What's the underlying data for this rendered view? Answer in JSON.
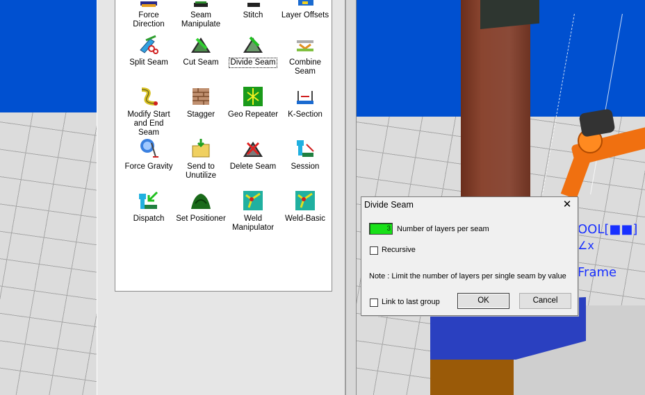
{
  "viewport": {
    "tool_label": "OOL[■■]",
    "axis_label": "∠x",
    "frame_label": "Frame"
  },
  "tools": [
    {
      "name": "force-direction",
      "label1": "Force",
      "label2": "Direction",
      "icon": "force-direction-icon"
    },
    {
      "name": "seam-manipulate",
      "label1": "Seam",
      "label2": "Manipulate",
      "icon": "seam-manipulate-icon"
    },
    {
      "name": "stitch",
      "label1": "Stitch",
      "label2": "",
      "icon": "stitch-icon"
    },
    {
      "name": "layer-offsets",
      "label1": "Layer Offsets",
      "label2": "",
      "icon": "layer-offsets-icon"
    },
    {
      "name": "split-seam",
      "label1": "Split Seam",
      "label2": "",
      "icon": "split-seam-icon"
    },
    {
      "name": "cut-seam",
      "label1": "Cut Seam",
      "label2": "",
      "icon": "cut-seam-icon"
    },
    {
      "name": "divide-seam",
      "label1": "Divide Seam",
      "label2": "",
      "icon": "divide-seam-icon"
    },
    {
      "name": "combine-seam",
      "label1": "Combine Seam",
      "label2": "",
      "icon": "combine-seam-icon"
    },
    {
      "name": "modify-start-end",
      "label1": "Modify Start",
      "label2": "and End Seam",
      "icon": "modify-start-end-icon"
    },
    {
      "name": "stagger",
      "label1": "Stagger",
      "label2": "",
      "icon": "stagger-icon"
    },
    {
      "name": "geo-repeater",
      "label1": "Geo Repeater",
      "label2": "",
      "icon": "geo-repeater-icon"
    },
    {
      "name": "k-section",
      "label1": "K-Section",
      "label2": "",
      "icon": "k-section-icon"
    },
    {
      "name": "force-gravity",
      "label1": "Force Gravity",
      "label2": "",
      "icon": "force-gravity-icon"
    },
    {
      "name": "send-to-unutilize",
      "label1": "Send to",
      "label2": "Unutilize",
      "icon": "send-to-folder-icon"
    },
    {
      "name": "delete-seam",
      "label1": "Delete Seam",
      "label2": "",
      "icon": "delete-seam-icon"
    },
    {
      "name": "session",
      "label1": "Session",
      "label2": "",
      "icon": "session-icon"
    },
    {
      "name": "dispatch",
      "label1": "Dispatch",
      "label2": "",
      "icon": "dispatch-icon"
    },
    {
      "name": "set-positioner",
      "label1": "Set Positioner",
      "label2": "",
      "icon": "set-positioner-icon"
    },
    {
      "name": "weld-manipulator",
      "label1": "Weld",
      "label2": "Manipulator",
      "icon": "weld-manipulator-icon"
    },
    {
      "name": "weld-basic",
      "label1": "Weld-Basic",
      "label2": "",
      "icon": "weld-basic-icon"
    }
  ],
  "dialog": {
    "title": "Divide Seam",
    "close": "✕",
    "layers_value": "3",
    "layers_label": "Number of layers per seam",
    "recursive_label": "Recursive",
    "note": "Note : Limit the number of layers per single seam by value",
    "link_label": "Link to last group",
    "ok_label": "OK",
    "cancel_label": "Cancel"
  },
  "colors": {
    "sky": "#0050d0",
    "input_green": "#18e018",
    "robot_orange": "#f07010"
  }
}
